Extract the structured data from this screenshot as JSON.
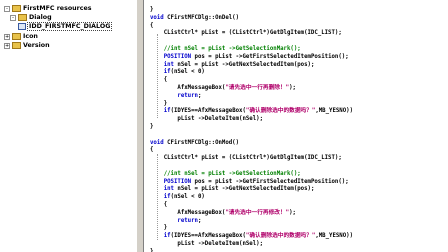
{
  "tree": {
    "root": "FirstMFC resources",
    "dialog": "Dialog",
    "dialog_item": "IDD_FIRSTMFC_DIALOG",
    "icon": "Icon",
    "version": "Version",
    "expanded_glyph": "-",
    "collapsed_glyph": "+"
  },
  "code": {
    "lines": [
      "}",
      "void CFirstMFCDlg::OnDel()",
      "{",
      "    CListCtrl* pList = (CListCtrl*)GetDlgItem(IDC_LIST);",
      "",
      "    //int nSel = pList ->GetSelectionMark();",
      "    POSITION pos = pList ->GetFirstSelectedItemPosition();",
      "    int nSel = pList ->GetNextSelectedItem(pos);",
      "    if(nSel < 0)",
      "    {",
      "        AfxMessageBox(\"请先选中一行再删除！\");",
      "        return;",
      "    }",
      "    if(IDYES==AfxMessageBox(\"确认删除选中的数据吗？\",MB_YESNO))",
      "        pList ->DeleteItem(nSel);",
      "}",
      "",
      "void CFirstMFCDlg::OnMod()",
      "{",
      "    CListCtrl* pList = (CListCtrl*)GetDlgItem(IDC_LIST);",
      "",
      "    //int nSel = pList ->GetSelectionMark();",
      "    POSITION pos = pList ->GetFirstSelectedItemPosition();",
      "    int nSel = pList ->GetNextSelectedItem(pos);",
      "    if(nSel < 0)",
      "    {",
      "        AfxMessageBox(\"请先选中一行再修改！\");",
      "        return;",
      "    }",
      "    if(IDYES==AfxMessageBox(\"确认删除选中的数据吗？\",MB_YESNO))",
      "        pList ->DeleteItem(nSel);",
      "}"
    ]
  },
  "colors": {
    "keyword": "#0000cc",
    "string": "#b0006a",
    "comment": "#008000",
    "folder": "#e8c24a"
  }
}
